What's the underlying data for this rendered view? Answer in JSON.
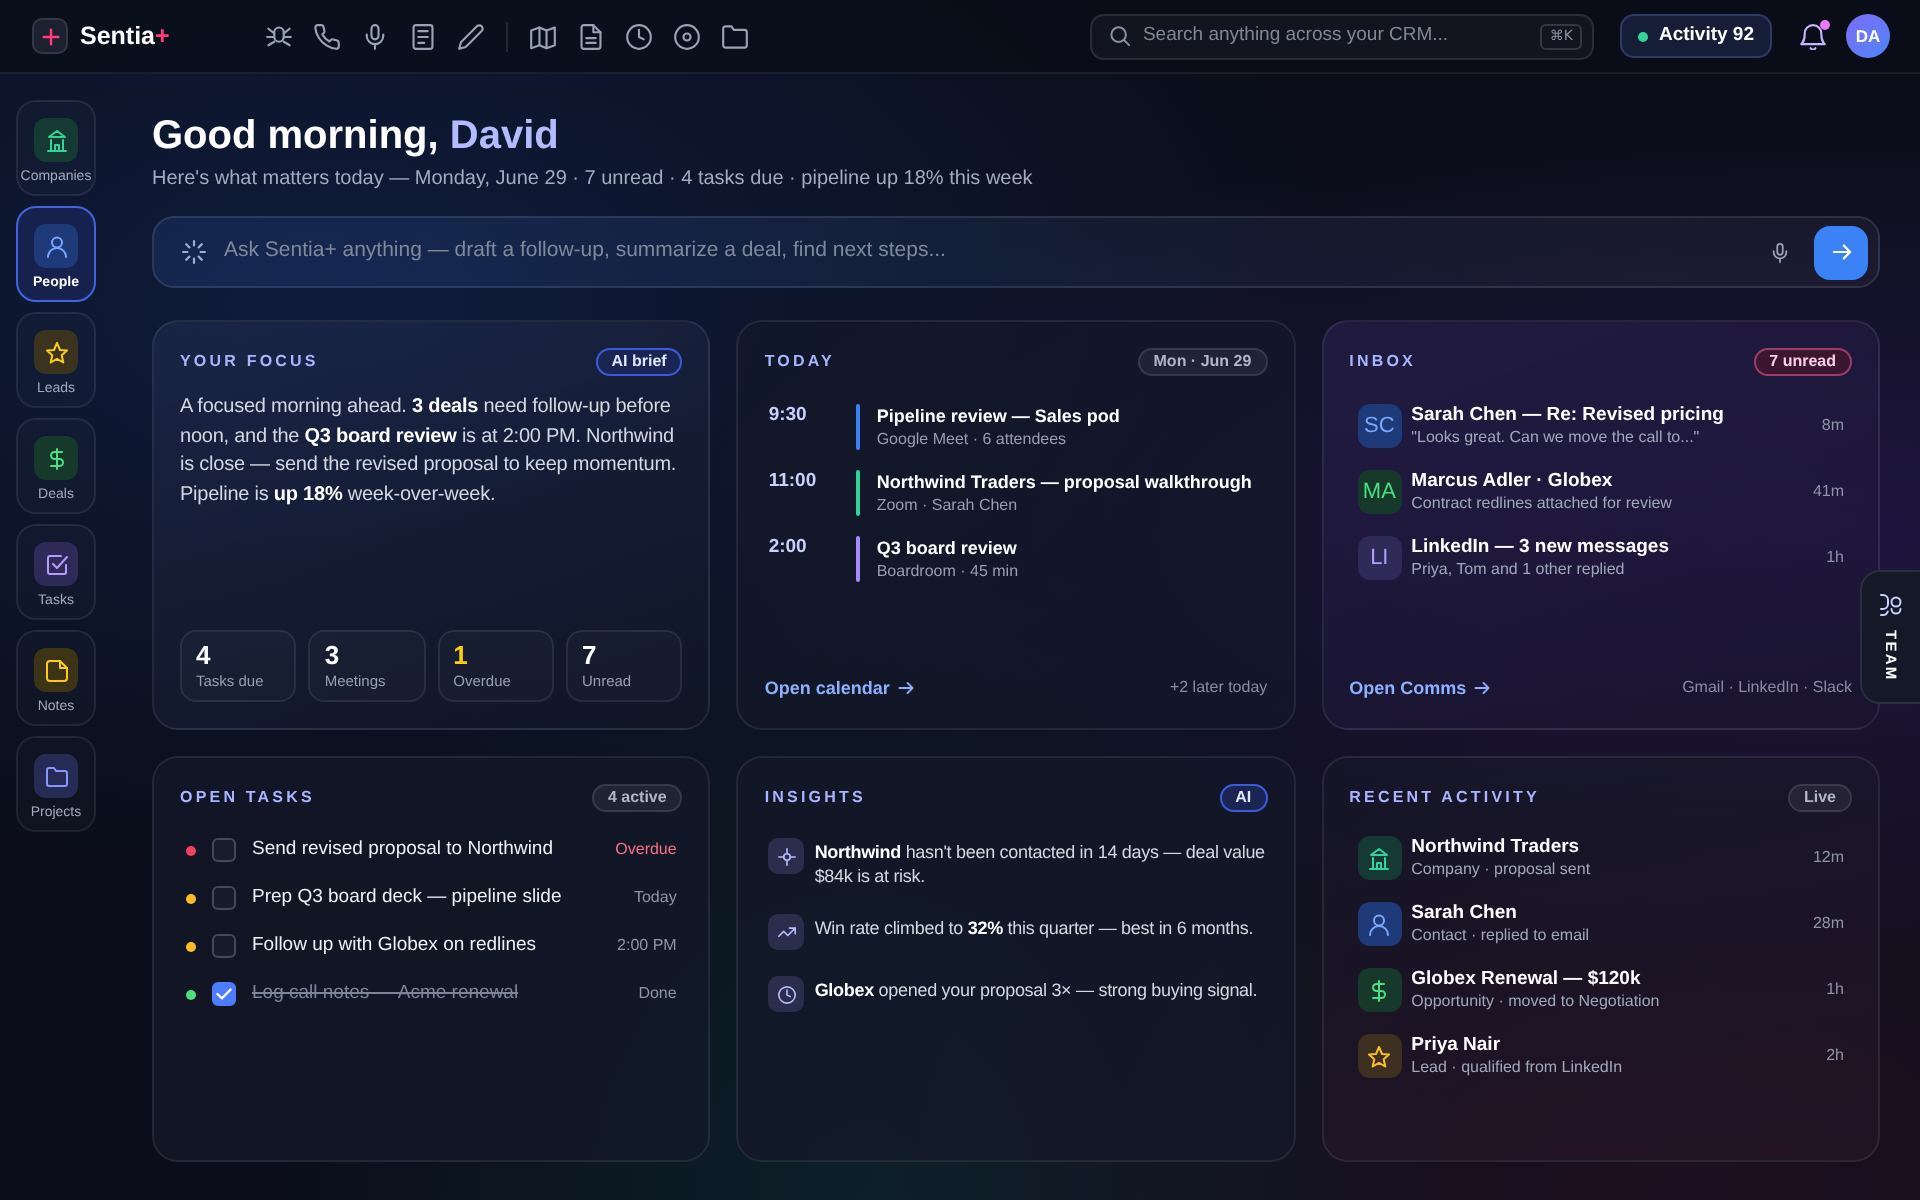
{
  "top_bar": {
    "brand": {
      "name": "Sentia",
      "accent": "+"
    },
    "search": {
      "placeholder": "Search anything across your CRM...",
      "shortcut": "⌘K"
    },
    "activity": {
      "label": "Activity 92"
    },
    "notifications": {
      "unread": true
    },
    "user": {
      "initials": "DA"
    }
  },
  "sidebar": {
    "items": [
      {
        "label": "Companies",
        "selected": false
      },
      {
        "label": "People",
        "selected": true
      },
      {
        "label": "Leads",
        "selected": false
      },
      {
        "label": "Deals",
        "selected": false
      },
      {
        "label": "Tasks",
        "selected": false
      },
      {
        "label": "Notes",
        "selected": false
      },
      {
        "label": "Projects",
        "selected": false
      }
    ]
  },
  "header": {
    "greeting": "Good morning,",
    "name": "David",
    "subtitle": "Here's what matters today — Monday, June 29 · 7 unread · 4 tasks due · pipeline up 18% this week"
  },
  "assistant": {
    "placeholder": "Ask Sentia+ anything — draft a follow-up, summarize a deal, find next steps..."
  },
  "focus": {
    "title": "YOUR FOCUS",
    "badge": "AI brief",
    "summary": "A focused morning ahead. **3 deals** need follow-up before noon, and the **Q3 board review** is at 2:00 PM. Northwind is close — send the revised proposal to keep momentum. Pipeline is **up 18%** week-over-week.",
    "stats": [
      {
        "value": "4",
        "label": "Tasks due",
        "highlighted": false
      },
      {
        "value": "3",
        "label": "Meetings",
        "highlighted": false
      },
      {
        "value": "1",
        "label": "Overdue",
        "highlighted": true
      },
      {
        "value": "7",
        "label": "Unread",
        "highlighted": false
      }
    ]
  },
  "today": {
    "title": "TODAY",
    "badge": "Mon · Jun 29",
    "events": [
      {
        "time": "9:30",
        "title": "Pipeline review — Sales pod",
        "details": "Google Meet · 6 attendees",
        "color": "#3b82f6"
      },
      {
        "time": "11:00",
        "title": "Northwind Traders — proposal walkthrough",
        "details": "Zoom · Sarah Chen",
        "color": "#34d399"
      },
      {
        "time": "2:00",
        "title": "Q3 board review",
        "details": "Boardroom · 45 min",
        "color": "#a78bfa"
      }
    ],
    "link": "Open calendar",
    "footnote": "+2 later today"
  },
  "inbox": {
    "title": "INBOX",
    "badge": "7 unread",
    "messages": [
      {
        "initials": "SC",
        "sender": "Sarah Chen — Re: Revised pricing",
        "preview": "\"Looks great. Can we move the call to...\"",
        "time": "8m"
      },
      {
        "initials": "MA",
        "sender": "Marcus Adler · Globex",
        "preview": "Contract redlines attached for review",
        "time": "41m"
      },
      {
        "initials": "LI",
        "sender": "LinkedIn — 3 new messages",
        "preview": "Priya, Tom and 1 other replied",
        "time": "1h"
      }
    ],
    "link": "Open Comms",
    "footnote": "Gmail · LinkedIn · Slack"
  },
  "tasks": {
    "title": "OPEN TASKS",
    "badge": "4 active",
    "items": [
      {
        "label": "Send revised proposal to Northwind",
        "due": "Overdue",
        "color": "#f43f5e",
        "checked": false,
        "overdue": true
      },
      {
        "label": "Prep Q3 board deck — pipeline slide",
        "due": "Today",
        "color": "#fbbf24",
        "checked": false,
        "overdue": false
      },
      {
        "label": "Follow up with Globex on redlines",
        "due": "2:00 PM",
        "color": "#fbbf24",
        "checked": false,
        "overdue": false
      },
      {
        "label": "Log call notes — Acme renewal",
        "due": "Done",
        "color": "#4ade80",
        "checked": true,
        "overdue": false
      }
    ]
  },
  "insights": {
    "title": "INSIGHTS",
    "badge": "AI",
    "items": [
      {
        "text": "**Northwind** hasn't been contacted in 14 days — deal value $84k is at risk."
      },
      {
        "text": "Win rate climbed to **32%** this quarter — best in 6 months."
      },
      {
        "text": "**Globex** opened your proposal 3× — strong buying signal."
      }
    ]
  },
  "recent_activity": {
    "title": "RECENT ACTIVITY",
    "badge": "Live",
    "events": [
      {
        "kind": "company",
        "title": "Northwind Traders",
        "details": "Company · proposal sent",
        "time": "12m"
      },
      {
        "kind": "contact",
        "title": "Sarah Chen",
        "details": "Contact · replied to email",
        "time": "28m"
      },
      {
        "kind": "deal",
        "title": "Globex Renewal — $120k",
        "details": "Opportunity · moved to Negotiation",
        "time": "1h"
      },
      {
        "kind": "lead",
        "title": "Priya Nair",
        "details": "Lead · qualified from LinkedIn",
        "time": "2h"
      }
    ]
  },
  "team_tab": {
    "label": "TEAM"
  }
}
